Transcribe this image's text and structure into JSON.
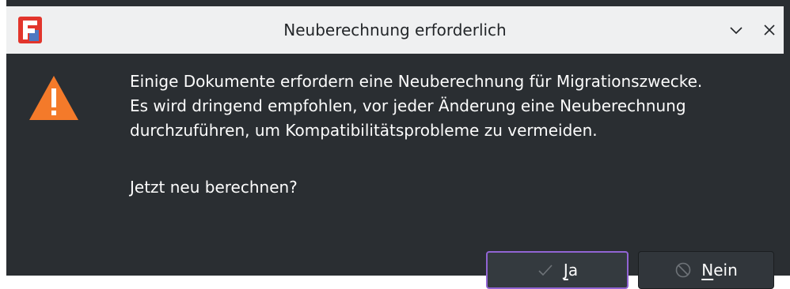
{
  "window": {
    "title": "Neuberechnung erforderlich",
    "app_icon": "freecad-logo-icon",
    "controls": {
      "minimize_icon": "chevron-down-icon",
      "close_icon": "close-icon"
    }
  },
  "dialog": {
    "icon": "warning-triangle-icon",
    "message_lines": [
      "Einige Dokumente erfordern eine Neuberechnung für Migrationszwecke.",
      "Es wird dringend empfohlen, vor jeder Änderung eine Neuberechnung",
      "durchzuführen, um Kompatibilitätsprobleme zu vermeiden."
    ],
    "question": "Jetzt neu berechnen?"
  },
  "buttons": {
    "yes": {
      "label_mnemonic": "J",
      "label_rest": "a",
      "icon": "checkmark-icon"
    },
    "no": {
      "label_mnemonic": "N",
      "label_rest": "ein",
      "icon": "cancel-icon"
    }
  },
  "colors": {
    "background": "#2a2e32",
    "titlebar": "#eff0f1",
    "text": "#fcfcfc",
    "warning": "#f47a2a",
    "focus_border": "#9164d4"
  }
}
